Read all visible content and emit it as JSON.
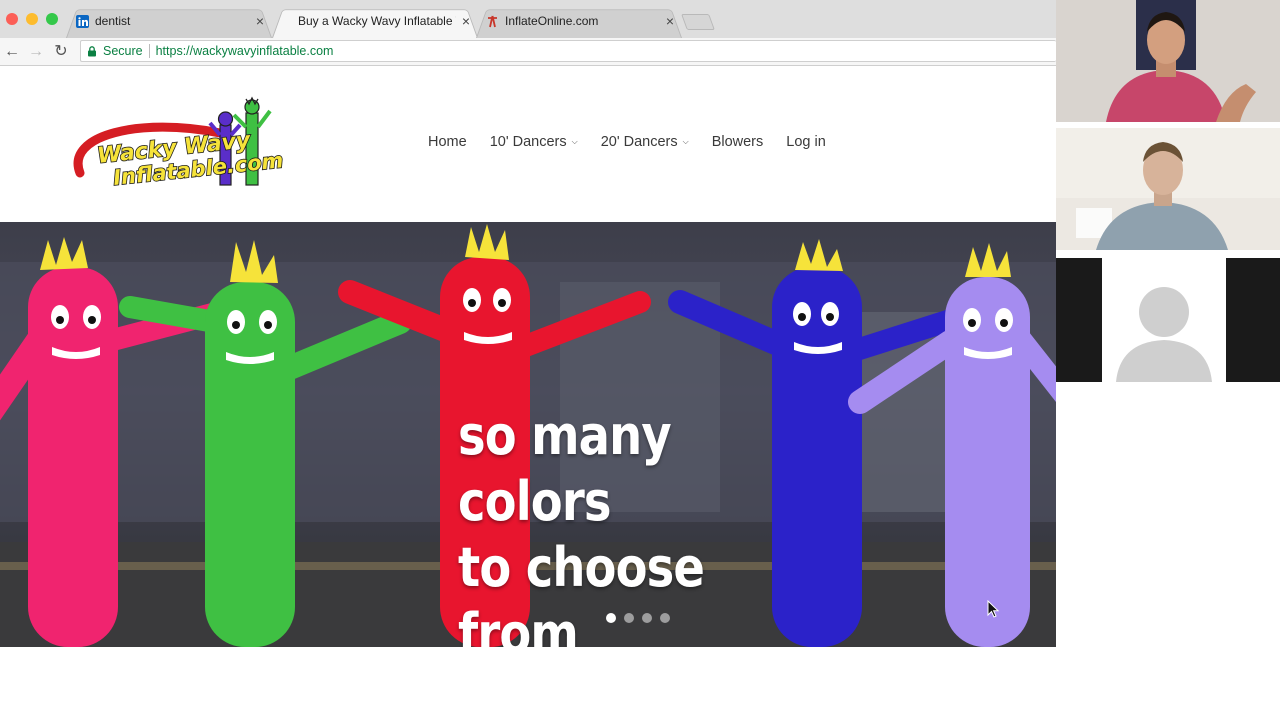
{
  "browser": {
    "tabs": [
      {
        "title": "dentist",
        "favicon": "linkedin-icon",
        "active": false
      },
      {
        "title": "Buy a Wacky Wavy Inflatable T",
        "favicon": "none",
        "active": true
      },
      {
        "title": "InflateOnline.com",
        "favicon": "inflateonline-icon",
        "active": false
      }
    ],
    "secure_label": "Secure",
    "url": "https://wackywavyinflatable.com"
  },
  "site": {
    "logo_text": [
      "Wacky Wavy",
      "Inflatable.com"
    ],
    "nav": [
      {
        "label": "Home",
        "dropdown": false
      },
      {
        "label": "10' Dancers",
        "dropdown": true
      },
      {
        "label": "20' Dancers",
        "dropdown": true
      },
      {
        "label": "Blowers",
        "dropdown": false
      },
      {
        "label": "Log in",
        "dropdown": false
      }
    ],
    "hero": {
      "line1": "so many colors",
      "line2": "to choose from",
      "slides": 4,
      "active_slide": 1
    }
  },
  "colors": {
    "pink": "#f0246f",
    "green": "#3fc043",
    "red": "#e8152e",
    "blue": "#2b22c9",
    "lavender": "#a58cf0",
    "orange": "#ff6a0a",
    "yellow": "#f6e33a"
  }
}
